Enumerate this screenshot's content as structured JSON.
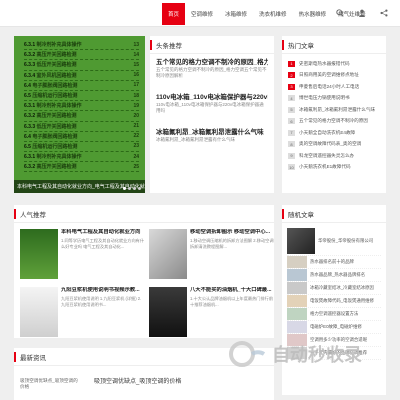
{
  "nav": {
    "items": [
      {
        "label": "首页",
        "active": true
      },
      {
        "label": "空调维修"
      },
      {
        "label": "冰箱维修"
      },
      {
        "label": "洗衣机维修"
      },
      {
        "label": "热水器维修"
      },
      {
        "label": "燃气灶维修"
      }
    ],
    "icons": [
      "search-icon",
      "user-icon",
      "share-icon"
    ]
  },
  "hero": {
    "lines": [
      {
        "num": "6.3.1",
        "text": "制冷剂补充具体操作",
        "page": "13"
      },
      {
        "num": "6.3.2",
        "text": "高压开关回路检测",
        "page": "14"
      },
      {
        "num": "6.3.3",
        "text": "低压开关回路检测",
        "page": "15"
      },
      {
        "num": "6.3.4",
        "text": "室外风机回路检测",
        "page": "16"
      },
      {
        "num": "6.4",
        "text": "电子膨胀阀回路检测",
        "page": "17"
      },
      {
        "num": "6.5",
        "text": "压缩机运行回路检测",
        "page": "18"
      },
      {
        "num": "6.3.1",
        "text": "制冷剂补充具体操作",
        "page": "19"
      },
      {
        "num": "6.3.2",
        "text": "高压开关回路检测",
        "page": "20"
      },
      {
        "num": "6.3.3",
        "text": "低压开关回路检测",
        "page": "21"
      },
      {
        "num": "6.4",
        "text": "电子膨胀阀回路检测",
        "page": "22"
      },
      {
        "num": "6.5",
        "text": "压缩机运行回路检测",
        "page": "23"
      },
      {
        "num": "6.3.1",
        "text": "制冷剂补充具体操作",
        "page": "24"
      },
      {
        "num": "6.3.2",
        "text": "高压开关回路检测",
        "page": "25"
      }
    ],
    "caption": "本科电气工程及其自动化就业方向_电气工程及其自动化就业方向"
  },
  "headlines": {
    "heading": "头条推荐",
    "items": [
      {
        "title": "五个常见的格力空调不制冷的原因_格力空调...",
        "summary": "五个常见的格力空调不制冷的原因_格力空调五个常见不制冷原因解析"
      },
      {
        "title": "110v电冰箱_110v电冰箱保护器与220v电...",
        "summary": "110v电冰箱_110v电冰箱保护器与220v电冰箱保护器通用吗"
      },
      {
        "title": "冰箱氟利昂_冰箱氟利昂泄露什么气味",
        "summary": "冰箱氟利昂_冰箱氟利昂泄露有什么气味"
      }
    ]
  },
  "hot": {
    "heading": "热门文章",
    "items": [
      "史密斯电热水器报错代码",
      "日照商用美的空调维修点地址",
      "申菱售后电话24小时人工电话",
      "博世电压力锅使用说明书",
      "冰箱氟利昂_冰箱氟利昂泄露什么气味",
      "五个常见的格力空调不制冷的原因",
      "小天鹅全自动洗衣机E4故障",
      "奥的空调故障代码表_奥的空调",
      "科龙空调遥控器失灵怎么办",
      "小天鹅洗衣机E1故障代码"
    ]
  },
  "popular": {
    "heading": "人气推荐",
    "items": [
      {
        "title": "本科电气工程及其自动化就业方向",
        "summary": "1.同等学历电气工程及其自动化就业方向有什么好专业吗 电气工程及其自动化..."
      },
      {
        "title": "移动空调拆卸图示 移动空调中心...",
        "summary": "1.移动空调压缩机的拆卸方法图解 2.移动空调拆卸清洗教程图解..."
      },
      {
        "title": "九阳豆浆机使用说明书视频示教...",
        "summary": "九阳豆浆机使用说明 1.九阳豆浆机 (详细) 2.九阳豆浆机使用说明书..."
      },
      {
        "title": "八大不能买的油烟机_十大口碑最...",
        "summary": "1.十大公认品牌油烟机以上年度最热门排行前十推荐油烟机..."
      }
    ]
  },
  "random": {
    "heading": "随机文章",
    "items": [
      "华帝股份_华帝股份有限公司",
      "热水器排名前十的品牌",
      "热水器品牌_热水器品牌排名",
      "冰箱冷藏室结冰_冷藏室结冰原因",
      "电饭煲故障代码_电饭煲通用维修",
      "格力空调遥控器设置方法",
      "电磁炉E0故障_电磁炉维修",
      "空调用多少功率的空调合适呢",
      "一千元内最好的品牌空调推荐"
    ]
  },
  "latest": {
    "heading": "最新资讯",
    "items": [
      {
        "alt": "吸顶空调优缺点_吸顶空调的价格",
        "title": "吸顶空调优缺点_吸顶空调的价格"
      }
    ]
  },
  "watermark": {
    "text": "自动秒收录"
  }
}
